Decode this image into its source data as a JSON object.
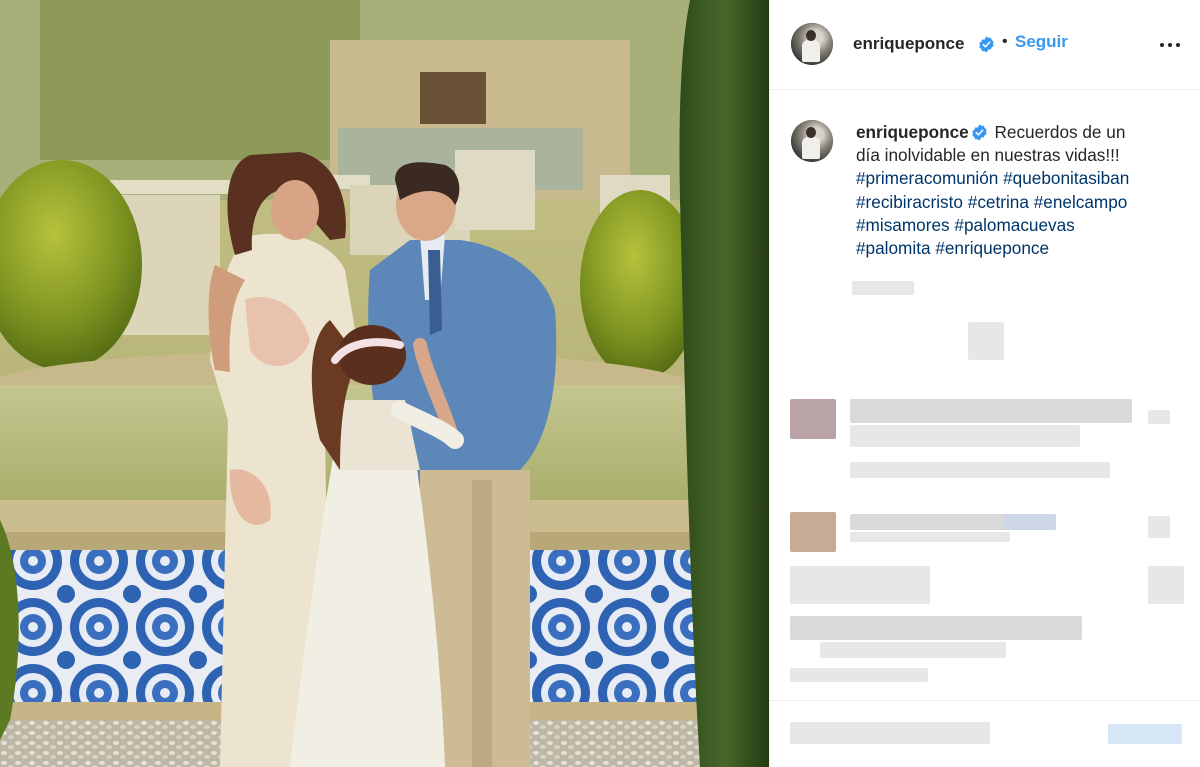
{
  "photo": {
    "alt_icon": "photo-image",
    "colors": {
      "water": "#b7bf80",
      "tile": "#2f63b0",
      "hedge": "#6e8a2a"
    }
  },
  "post": {
    "username": "enriqueponce",
    "verified_icon": "verified-badge-icon",
    "separator": "•",
    "follow_label": "Seguir",
    "more_icon": "more-options-icon",
    "caption": {
      "username": "enriqueponce",
      "text_line1": "Recuerdos de un",
      "text_line2": "día inolvidable en nuestras vidas!!!",
      "hashtags": [
        "#primeracomunión",
        "#quebonitasiban",
        "#recibiracristo",
        "#cetrina",
        "#enelcampo",
        "#misamores",
        "#palomacuevas",
        "#palomita",
        "#enriqueponce"
      ]
    }
  },
  "colors": {
    "accent": "#3897f0",
    "verified": "#3897f0",
    "text": "#262626",
    "hashtag": "#003569"
  }
}
